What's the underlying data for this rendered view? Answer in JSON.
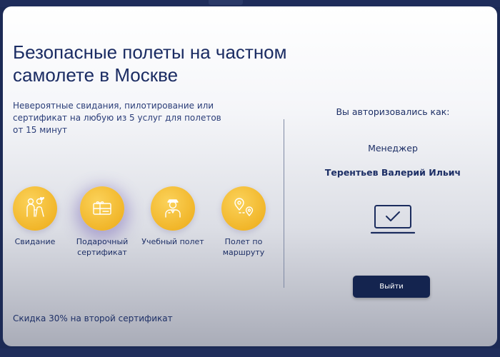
{
  "page": {
    "title": "Безопасные полеты на частном самолете в Москве",
    "subtitle": "Невероятные свидания, пилотирование или сертификат на любую из 5 услуг для полетов от 15 минут",
    "promo": "Скидка 30% на второй сертификат"
  },
  "services": [
    {
      "label": "Свидание",
      "icon": "couple-icon"
    },
    {
      "label": "Подарочный сертификат",
      "icon": "gift-certificate-icon"
    },
    {
      "label": "Учебный полет",
      "icon": "pilot-icon"
    },
    {
      "label": "Полет по маршруту",
      "icon": "route-pins-icon"
    }
  ],
  "auth": {
    "title": "Вы авторизовались как:",
    "role": "Менеджер",
    "name": "Терентьев Валерий Ильич",
    "icon": "laptop-check-icon",
    "logout_label": "Выйти"
  },
  "colors": {
    "accent_yellow": "#f1b62a",
    "text_navy": "#1d2f66",
    "button_navy": "#14244f",
    "frame_navy": "#1f2d5b"
  }
}
